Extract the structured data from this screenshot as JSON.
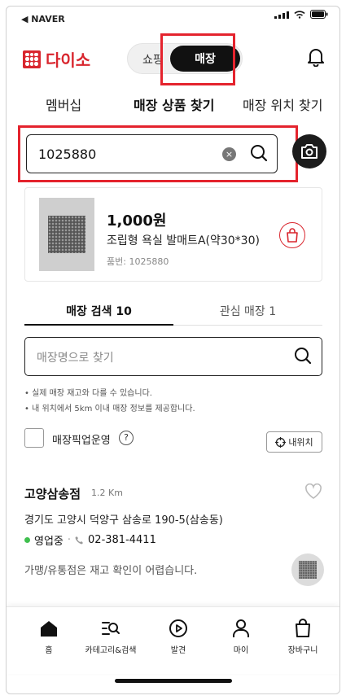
{
  "status_bar": {
    "back_app": "◀ NAVER"
  },
  "header": {
    "logo_text": "다이소",
    "segment": {
      "shop_label": "쇼핑",
      "store_label": "매장"
    }
  },
  "tabs": [
    {
      "label": "멤버십",
      "active": false
    },
    {
      "label": "매장 상품 찾기",
      "active": true
    },
    {
      "label": "매장 위치 찾기",
      "active": false
    }
  ],
  "search": {
    "value": "1025880",
    "clear_icon": "×"
  },
  "product": {
    "price": "1,000원",
    "name": "조립형 욕실 발매트A(약30*30)",
    "code": "품번: 1025880"
  },
  "sub_tabs": [
    {
      "label": "매장 검색 10",
      "active": true
    },
    {
      "label": "관심 매장 1",
      "active": false
    }
  ],
  "store_search": {
    "placeholder": "매장명으로 찾기"
  },
  "notes": [
    "실제 매장 재고와 다를 수 있습니다.",
    "내 위치에서 5km 이내 매장 정보를 제공합니다."
  ],
  "pickup": {
    "label": "매장픽업운영",
    "help": "?",
    "checked": false
  },
  "my_location": {
    "label": "내위치"
  },
  "store": {
    "name": "고양삼송점",
    "distance": "1.2 Km",
    "address": "경기도 고양시 덕양구 삼송로 190-5(삼송동)",
    "status": "영업중",
    "separator": "·",
    "phone": "02-381-4411",
    "note": "가맹/유통점은 재고 확인이 어렵습니다."
  },
  "bottom_nav": [
    {
      "label": "홈",
      "icon": "home-icon"
    },
    {
      "label": "카테고리&검색",
      "icon": "category-search-icon"
    },
    {
      "label": "발견",
      "icon": "discover-icon"
    },
    {
      "label": "마이",
      "icon": "person-icon"
    },
    {
      "label": "장바구니",
      "icon": "cart-bag-icon"
    }
  ],
  "colors": {
    "brand": "#d9262e",
    "highlight": "#e4232d",
    "open_status": "#3fbf4e"
  }
}
